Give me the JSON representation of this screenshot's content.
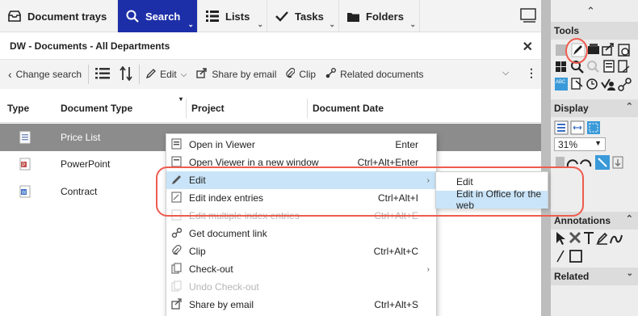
{
  "nav": {
    "tabs": [
      {
        "label": "Document trays",
        "icon": "tray-icon"
      },
      {
        "label": "Search",
        "icon": "search-icon"
      },
      {
        "label": "Lists",
        "icon": "list-icon"
      },
      {
        "label": "Tasks",
        "icon": "checkmark-icon"
      },
      {
        "label": "Folders",
        "icon": "folder-icon"
      }
    ]
  },
  "window": {
    "title": "DW - Documents - All Departments"
  },
  "toolbar": {
    "change_search": "Change search",
    "edit": "Edit",
    "share": "Share by email",
    "clip": "Clip",
    "related": "Related documents"
  },
  "table": {
    "headers": [
      "Type",
      "Document Type",
      "Project",
      "Document Date"
    ],
    "rows": [
      {
        "type_icon": "list-doc-icon",
        "document_type": "Price List"
      },
      {
        "type_icon": "powerpoint-icon",
        "document_type": "PowerPoint"
      },
      {
        "type_icon": "word-doc-icon",
        "document_type": "Contract"
      }
    ]
  },
  "side": {
    "tools": "Tools",
    "display": "Display",
    "zoom": "31%",
    "annotations": "Annotations",
    "related": "Related"
  },
  "menu": {
    "items": [
      {
        "label": "Open in Viewer",
        "shortcut": "Enter",
        "icon": "viewer-icon"
      },
      {
        "label": "Open Viewer in a new window",
        "shortcut": "Ctrl+Alt+Enter",
        "icon": "new-window-icon"
      },
      {
        "label": "Edit",
        "shortcut": "",
        "icon": "pencil-icon"
      },
      {
        "label": "Edit index entries",
        "shortcut": "Ctrl+Alt+I",
        "icon": "index-icon"
      },
      {
        "label": "Edit multiple index entries",
        "shortcut": "Ctrl+Alt+E",
        "icon": "multi-index-icon"
      },
      {
        "label": "Get document link",
        "shortcut": "",
        "icon": "link-icon"
      },
      {
        "label": "Clip",
        "shortcut": "Ctrl+Alt+C",
        "icon": "paperclip-icon"
      },
      {
        "label": "Check-out",
        "shortcut": "",
        "icon": "copy-icon"
      },
      {
        "label": "Undo Check-out",
        "shortcut": "",
        "icon": "undo-icon"
      },
      {
        "label": "Share by email",
        "shortcut": "Ctrl+Alt+S",
        "icon": "share-icon"
      }
    ],
    "submenu": [
      "Edit",
      "Edit in Office for the web"
    ]
  },
  "colors": {
    "accent": "#1d2fa8",
    "highlight": "#c9e4f8",
    "callout": "#ee5c4e",
    "selected_row": "#8c8c8c"
  }
}
